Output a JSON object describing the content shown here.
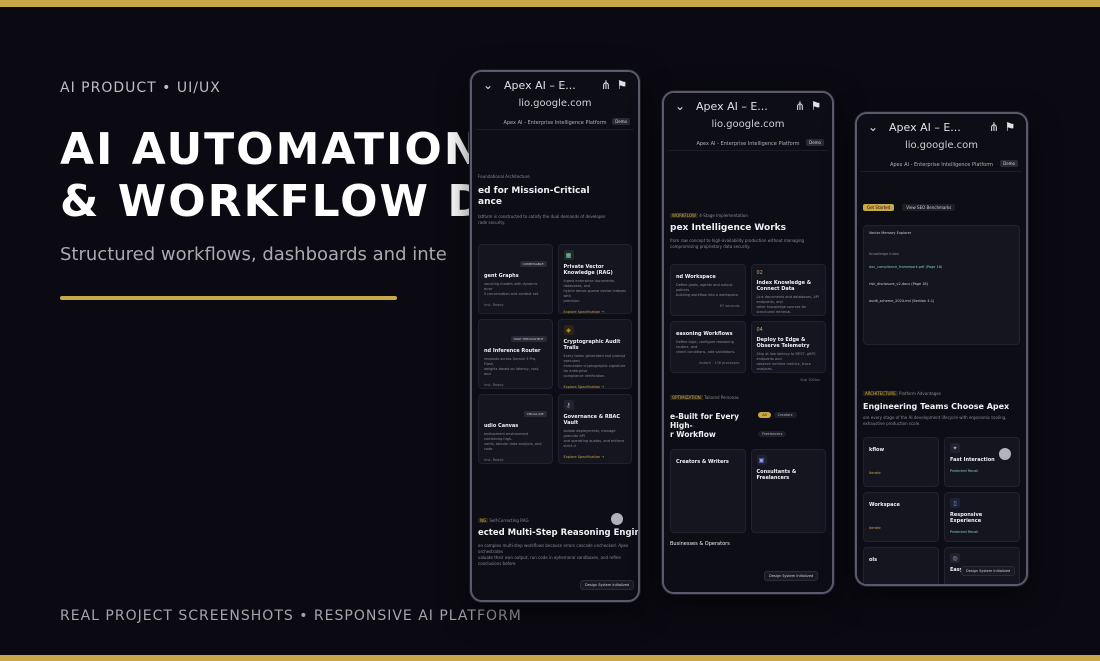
{
  "eyebrow": "AI PRODUCT • UI/UX",
  "headline": {
    "line1": "AI AUTOMATION",
    "line2": "& WORKFLOW DE"
  },
  "subline": "Structured workflows, dashboards and inte",
  "footer": "REAL PROJECT SCREENSHOTS • RESPONSIVE AI PLATFORM",
  "colors": {
    "accent": "#c9a84a",
    "background": "#0b0a12"
  },
  "phones": [
    {
      "browser_title": "Apex AI – E...",
      "url": "lio.google.com",
      "app_title": "Apex AI - Enterprise Intelligence Platform",
      "demo_button": "Demo",
      "section_kicker": "Foundational Architecture",
      "heading": "ed for Mission-Critical\nance",
      "heading_desc": "latform is constructed to satisfy the dual demands of developer\nrade security.",
      "cards": [
        {
          "badge": "COMPOSABLE",
          "title": "gent Graphs",
          "desc": "xecuting models with dynamic error\nll conversation and context set",
          "link": "Inst. Ready"
        },
        {
          "title": "Private Vector Knowledge (RAG)",
          "desc": "Ingest enterprise documents, databases, and\nhybrid dense-sparse vector indexes with\nprecision.",
          "link": "Explore Specification →"
        },
        {
          "badge": "HIGH THROUGHPUT",
          "title": "nd Inference Router",
          "desc": "requests across Gemini 3 Pro, Flash,\nweights based on latency, cost, and",
          "link": "Inst. Ready"
        },
        {
          "title": "Cryptographic Audit Trails",
          "desc": "Every token generated and prompt executed\nimmutable cryptographic signature for enterprise\ncompliance verification.",
          "link": "Explore Specification →"
        },
        {
          "badge": "VISUAL IDE",
          "title": "udio Canvas",
          "desc": "evelopment environment combining high-\nvents, tabular data analysis, and code",
          "link": "Inst. Ready"
        },
        {
          "title": "Governance & RBAC Vault",
          "desc": "Isolate deployments, manage granular API\nand operating quotas, and enforce strict d",
          "link": "Explore Specification →"
        }
      ],
      "lower_tag": "NG",
      "lower_kicker": "Self-Correcting RAG",
      "lower_heading": "ected Multi-Step Reasoning Engines",
      "lower_desc": "on complex multi-step workflows because errors cascade unchecked. Apex orchestrates\nvaluate their own output, run code in ephemeral sandboxes, and refine conclusions before",
      "toast": "Design System Initialized"
    },
    {
      "browser_title": "Apex AI – E...",
      "url": "lio.google.com",
      "app_title": "Apex AI - Enterprise Intelligence Platform",
      "demo_button": "Demo",
      "tag": "WORKFLOW",
      "kicker": "4-Stage Implementation",
      "heading": "pex Intelligence Works",
      "heading_desc": "from raw concept to high-availability production without managing\ncompromising proprietary data security.",
      "steps": [
        {
          "num": "",
          "title": "nd Workspace",
          "desc": "Define goals, agents and output policies\nbuilding workflow into a workspace.",
          "foot": "67 seconds"
        },
        {
          "num": "02",
          "title": "Index Knowledge & Connect Data",
          "desc": "Link documents and databases, API endpoints, and\nother knowledge sources for structured retrieval.",
          "foot": "Apply action"
        },
        {
          "num": "",
          "title": "easoning Workflows",
          "desc": "Define logic, configure reasoning routers, and\ncheck conditions, add validations.",
          "foot": "Instant · 136 processes"
        },
        {
          "num": "04",
          "title": "Deploy to Edge & Observe Telemetry",
          "desc": "Ship at low latency to REST, gRPC endpoints and\nobserve runtime metrics, trace analyses.",
          "foot": "Sub 100ms"
        }
      ],
      "tag2": "OPTIMIZATION",
      "kicker2": "Tailored Personas",
      "heading2": "e-Built for Every High-\nr Workflow",
      "pills": [
        "All",
        "Creators",
        "Freelancers"
      ],
      "persona_left": "Creators & Writers",
      "persona_right": "Consultants & Freelancers",
      "persona_bottom": "Businesses & Operators",
      "toast": "Design System Initialized"
    },
    {
      "browser_title": "Apex AI – E...",
      "url": "lio.google.com",
      "app_title": "Apex AI - Enterprise Intelligence Platform",
      "demo_button": "Demo",
      "cta_primary": "Get Started",
      "cta_secondary": "View SEO Benchmarks",
      "feed": [
        "Vector Memory Explorer",
        "Knowledge Index",
        "doc_compliance_framework.pdf (Page 16)",
        "risk_disclosure_v2.docx (Page 18)",
        "audit_scheme_2024.md (Section 4.1)"
      ],
      "tag": "ARCHITECTURE",
      "kicker": "Platform Advantages",
      "heading": "Engineering Teams Choose Apex",
      "heading_desc": "ore every stage of the AI development lifecycle with ergonomic tooling,\nexhaustive production scale.",
      "cards": [
        {
          "title": "kflow",
          "link": "Iterate"
        },
        {
          "title": "Fast Interaction",
          "link": "Protected Recall"
        },
        {
          "title": "Workspace",
          "link": "Iterate"
        },
        {
          "title": "Responsive Experience",
          "link": "Protected Recall"
        },
        {
          "title": "ols",
          "link": ""
        },
        {
          "title": "Easy Navigation",
          "link": ""
        }
      ],
      "toast": "Design System Initialized"
    }
  ]
}
